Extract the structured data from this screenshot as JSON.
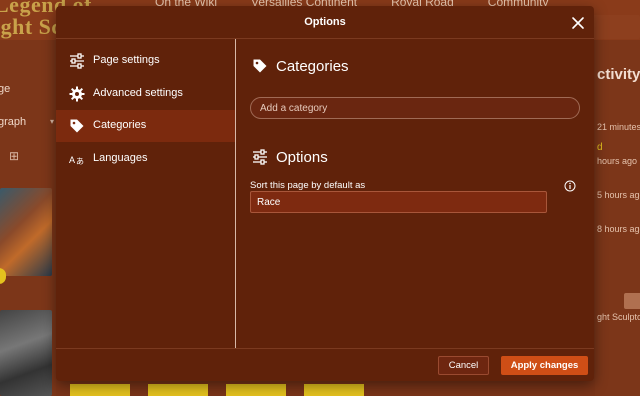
{
  "background": {
    "logo_line1": "Legend of",
    "logo_line2": "ight Sc",
    "nav": [
      "On the Wiki",
      "Versailles Continent",
      "Royal Road",
      "Community"
    ],
    "left_labels": [
      "ge",
      "graph"
    ],
    "right_title": "ctivity",
    "right_timestamps": [
      "21 minutes",
      "d",
      "hours ago",
      "5 hours ago",
      "8 hours ago"
    ],
    "right_caption": "ght Sculpto"
  },
  "modal": {
    "title": "Options",
    "sidebar": [
      {
        "label": "Page settings",
        "icon": "sliders-icon"
      },
      {
        "label": "Advanced settings",
        "icon": "gear-icon"
      },
      {
        "label": "Categories",
        "icon": "tag-icon",
        "active": true
      },
      {
        "label": "Languages",
        "icon": "translate-icon"
      }
    ],
    "categories": {
      "title": "Categories",
      "input_placeholder": "Add a category"
    },
    "options": {
      "title": "Options",
      "sort_label": "Sort this page by default as",
      "sort_value": "Race"
    },
    "footer": {
      "cancel_label": "Cancel",
      "apply_label": "Apply changes"
    }
  },
  "colors": {
    "modal_bg": "#60220a",
    "active_item": "#7c2a0e",
    "primary_button": "#cf4e16"
  }
}
